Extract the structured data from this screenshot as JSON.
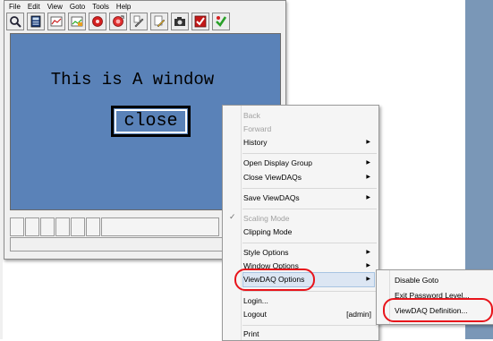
{
  "app_window": {
    "menubar": [
      "File",
      "Edit",
      "View",
      "Goto",
      "Tools",
      "Help"
    ],
    "toolbar_icons": [
      "magnify-icon",
      "calculator-icon",
      "chart-icon",
      "chart-edit-icon",
      "red-gauge-icon",
      "red-gauge-plus-icon",
      "script-icon",
      "script-edit-icon",
      "camera-icon",
      "red-check-icon",
      "green-check-icon"
    ],
    "canvas_title": "This is A window",
    "close_button_label": "close"
  },
  "context_menu": {
    "items": [
      {
        "label": "Back",
        "disabled": true
      },
      {
        "label": "Forward",
        "disabled": true
      },
      {
        "label": "History",
        "submenu": true
      },
      {
        "label": "Open Display Group",
        "submenu": true
      },
      {
        "label": "Close ViewDAQs",
        "submenu": true
      },
      {
        "label": "Save ViewDAQs",
        "submenu": true
      },
      {
        "label": "Scaling Mode",
        "disabled": true,
        "checked": true
      },
      {
        "label": "Clipping Mode"
      },
      {
        "label": "Style Options",
        "submenu": true
      },
      {
        "label": "Window Options",
        "submenu": true
      },
      {
        "label": "ViewDAQ Options",
        "submenu": true,
        "highlighted": true
      },
      {
        "label": "Login..."
      },
      {
        "label": "Logout",
        "shortcut": "[admin]"
      },
      {
        "label": "Print"
      }
    ],
    "check_glyph": "✓",
    "arrow_glyph": "▶"
  },
  "submenu": {
    "items": [
      "Disable Goto",
      "Exit Password Level...",
      "ViewDAQ Definition..."
    ]
  },
  "annotation_color": "#e8141b"
}
